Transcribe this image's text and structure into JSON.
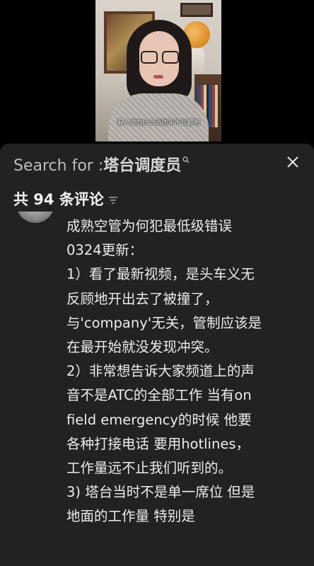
{
  "video": {
    "caption": "有人说为什么消防车不会翻吧"
  },
  "search": {
    "prefix": "Search for : ",
    "term": "塔台调度员"
  },
  "comments_header": {
    "count_text": "共 94 条评论"
  },
  "comment": {
    "lines": [
      "成熟空管为何犯最低级错误",
      "0324更新：",
      "1）看了最新视频，是头车义无",
      "反顾地开出去了被撞了，",
      "与'company'无关，管制应该是",
      "在最开始就没发现冲突。",
      "2）非常想告诉大家频道上的声",
      "音不是ATC的全部工作 当有on",
      "field emergency的时候 他要",
      "各种打接电话 要用hotlines，",
      "工作量远不止我们听到的。",
      "3) 塔台当时不是单一席位 但是",
      "地面的工作量 特别是"
    ]
  },
  "icons": {
    "search": "search-icon",
    "close": "close-icon",
    "sort": "sort-icon"
  }
}
